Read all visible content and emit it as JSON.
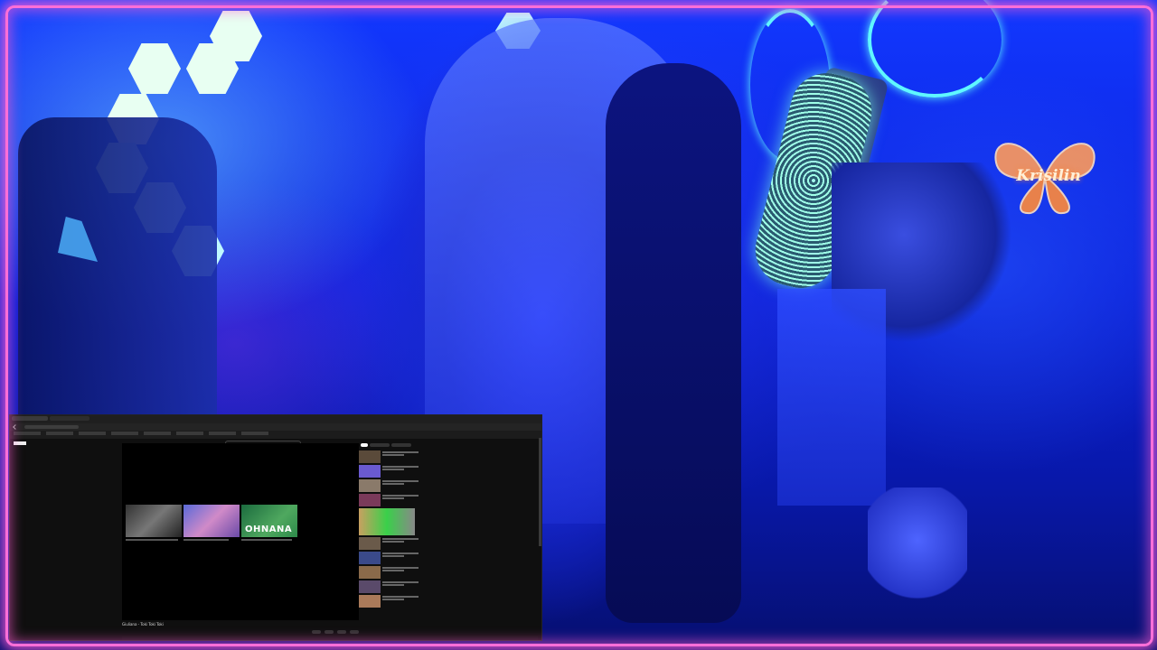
{
  "scene": {
    "logo_text": "Krisilin",
    "colors": {
      "frame": "#ff6fd8",
      "ambient": "#1238ff",
      "neon": "#5ff7ff"
    }
  },
  "browser": {
    "video": {
      "title": "Giuliana - Toki Toki Toki",
      "overlay_text": "OHNANA"
    }
  }
}
